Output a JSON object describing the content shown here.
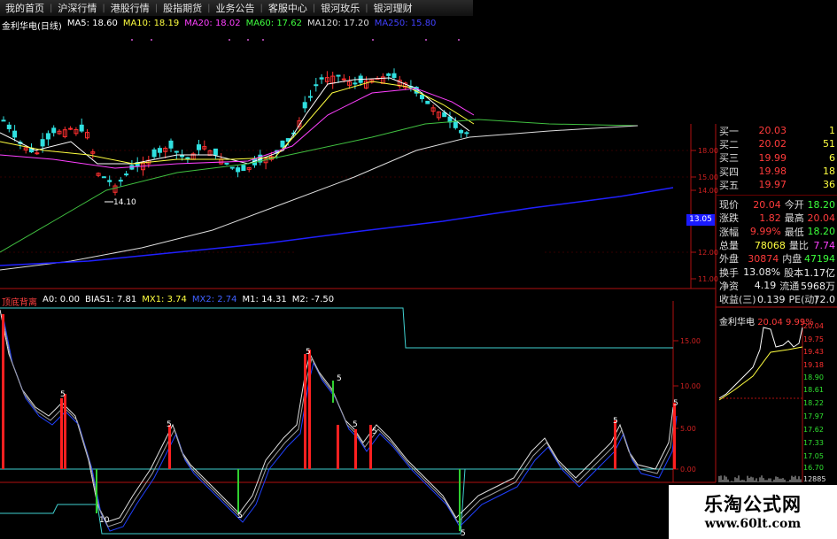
{
  "menu": {
    "items": [
      "我的首页",
      "沪深行情",
      "港股行情",
      "股指期货",
      "业务公告",
      "客服中心",
      "银河玫乐",
      "银河理财"
    ]
  },
  "main_chart": {
    "title": "金利华电(日线)",
    "ma": [
      {
        "label": "MA5: 18.60",
        "color": "#ffffff"
      },
      {
        "label": "MA10: 18.19",
        "color": "#ffff40"
      },
      {
        "label": "MA20: 18.02",
        "color": "#ff40ff"
      },
      {
        "label": "MA60: 17.62",
        "color": "#40ff40"
      },
      {
        "label": "MA120: 17.20",
        "color": "#dddddd"
      },
      {
        "label": "MA250: 15.80",
        "color": "#4040ff"
      }
    ],
    "y_ticks": [
      "18.00",
      "15.00",
      "14.00",
      "12.00",
      "11.00"
    ],
    "low_label": "14.10",
    "price_tag": "13.05"
  },
  "indicator": {
    "title": "顶底背离",
    "params": [
      {
        "label": "A0: 0.00",
        "color": "#ffffff"
      },
      {
        "label": "BIAS1: 7.81",
        "color": "#ffffff"
      },
      {
        "label": "MX1: 3.74",
        "color": "#ffff40"
      },
      {
        "label": "MX2: 2.74",
        "color": "#4060ff"
      },
      {
        "label": "M1: 14.31",
        "color": "#ffffff"
      },
      {
        "label": "M2: -7.50",
        "color": "#ffffff"
      }
    ],
    "y_ticks": [
      "15.00",
      "10.00",
      "5.00",
      "0.00"
    ],
    "marks": [
      "5",
      "5",
      "5",
      "10",
      "5",
      "5",
      "5",
      "5",
      "5",
      "5",
      "5"
    ]
  },
  "quote": {
    "bids": [
      {
        "label": "买一",
        "price": "20.03",
        "vol": "1"
      },
      {
        "label": "买二",
        "price": "20.02",
        "vol": "51"
      },
      {
        "label": "买三",
        "price": "19.99",
        "vol": "6"
      },
      {
        "label": "买四",
        "price": "19.98",
        "vol": "18"
      },
      {
        "label": "买五",
        "price": "19.97",
        "vol": "36"
      }
    ],
    "stats": [
      {
        "k1": "现价",
        "v1": "20.04",
        "c1": "red",
        "k2": "今开",
        "v2": "18.20",
        "c2": "green"
      },
      {
        "k1": "涨跌",
        "v1": "1.82",
        "c1": "red",
        "k2": "最高",
        "v2": "20.04",
        "c2": "red"
      },
      {
        "k1": "涨幅",
        "v1": "9.99%",
        "c1": "red",
        "k2": "最低",
        "v2": "18.20",
        "c2": "green"
      },
      {
        "k1": "总量",
        "v1": "78068",
        "c1": "yel",
        "k2": "量比",
        "v2": "7.74",
        "c2": "mag"
      },
      {
        "k1": "外盘",
        "v1": "30874",
        "c1": "red",
        "k2": "内盘",
        "v2": "47194",
        "c2": "green"
      },
      {
        "k1": "换手",
        "v1": "13.08%",
        "c1": "white",
        "k2": "股本",
        "v2": "1.17亿",
        "c2": "white"
      },
      {
        "k1": "净资",
        "v1": "4.19",
        "c1": "white",
        "k2": "流通",
        "v2": "5968万",
        "c2": "white"
      },
      {
        "k1": "收益(三)",
        "v1": "0.139",
        "c1": "white",
        "k2": "PE(动)",
        "v2": "72.0",
        "c2": "white"
      }
    ]
  },
  "mini_chart": {
    "name": "金利华电",
    "price": "20.04",
    "pct": "9.99%",
    "y_ticks": [
      "20.04",
      "19.75",
      "19.43",
      "19.18",
      "18.90",
      "18.61",
      "18.22",
      "17.97",
      "17.62",
      "17.33",
      "17.05",
      "16.70",
      "12885"
    ]
  },
  "watermark": {
    "line1": "乐淘公式网",
    "line2": "www.60lt.com"
  }
}
